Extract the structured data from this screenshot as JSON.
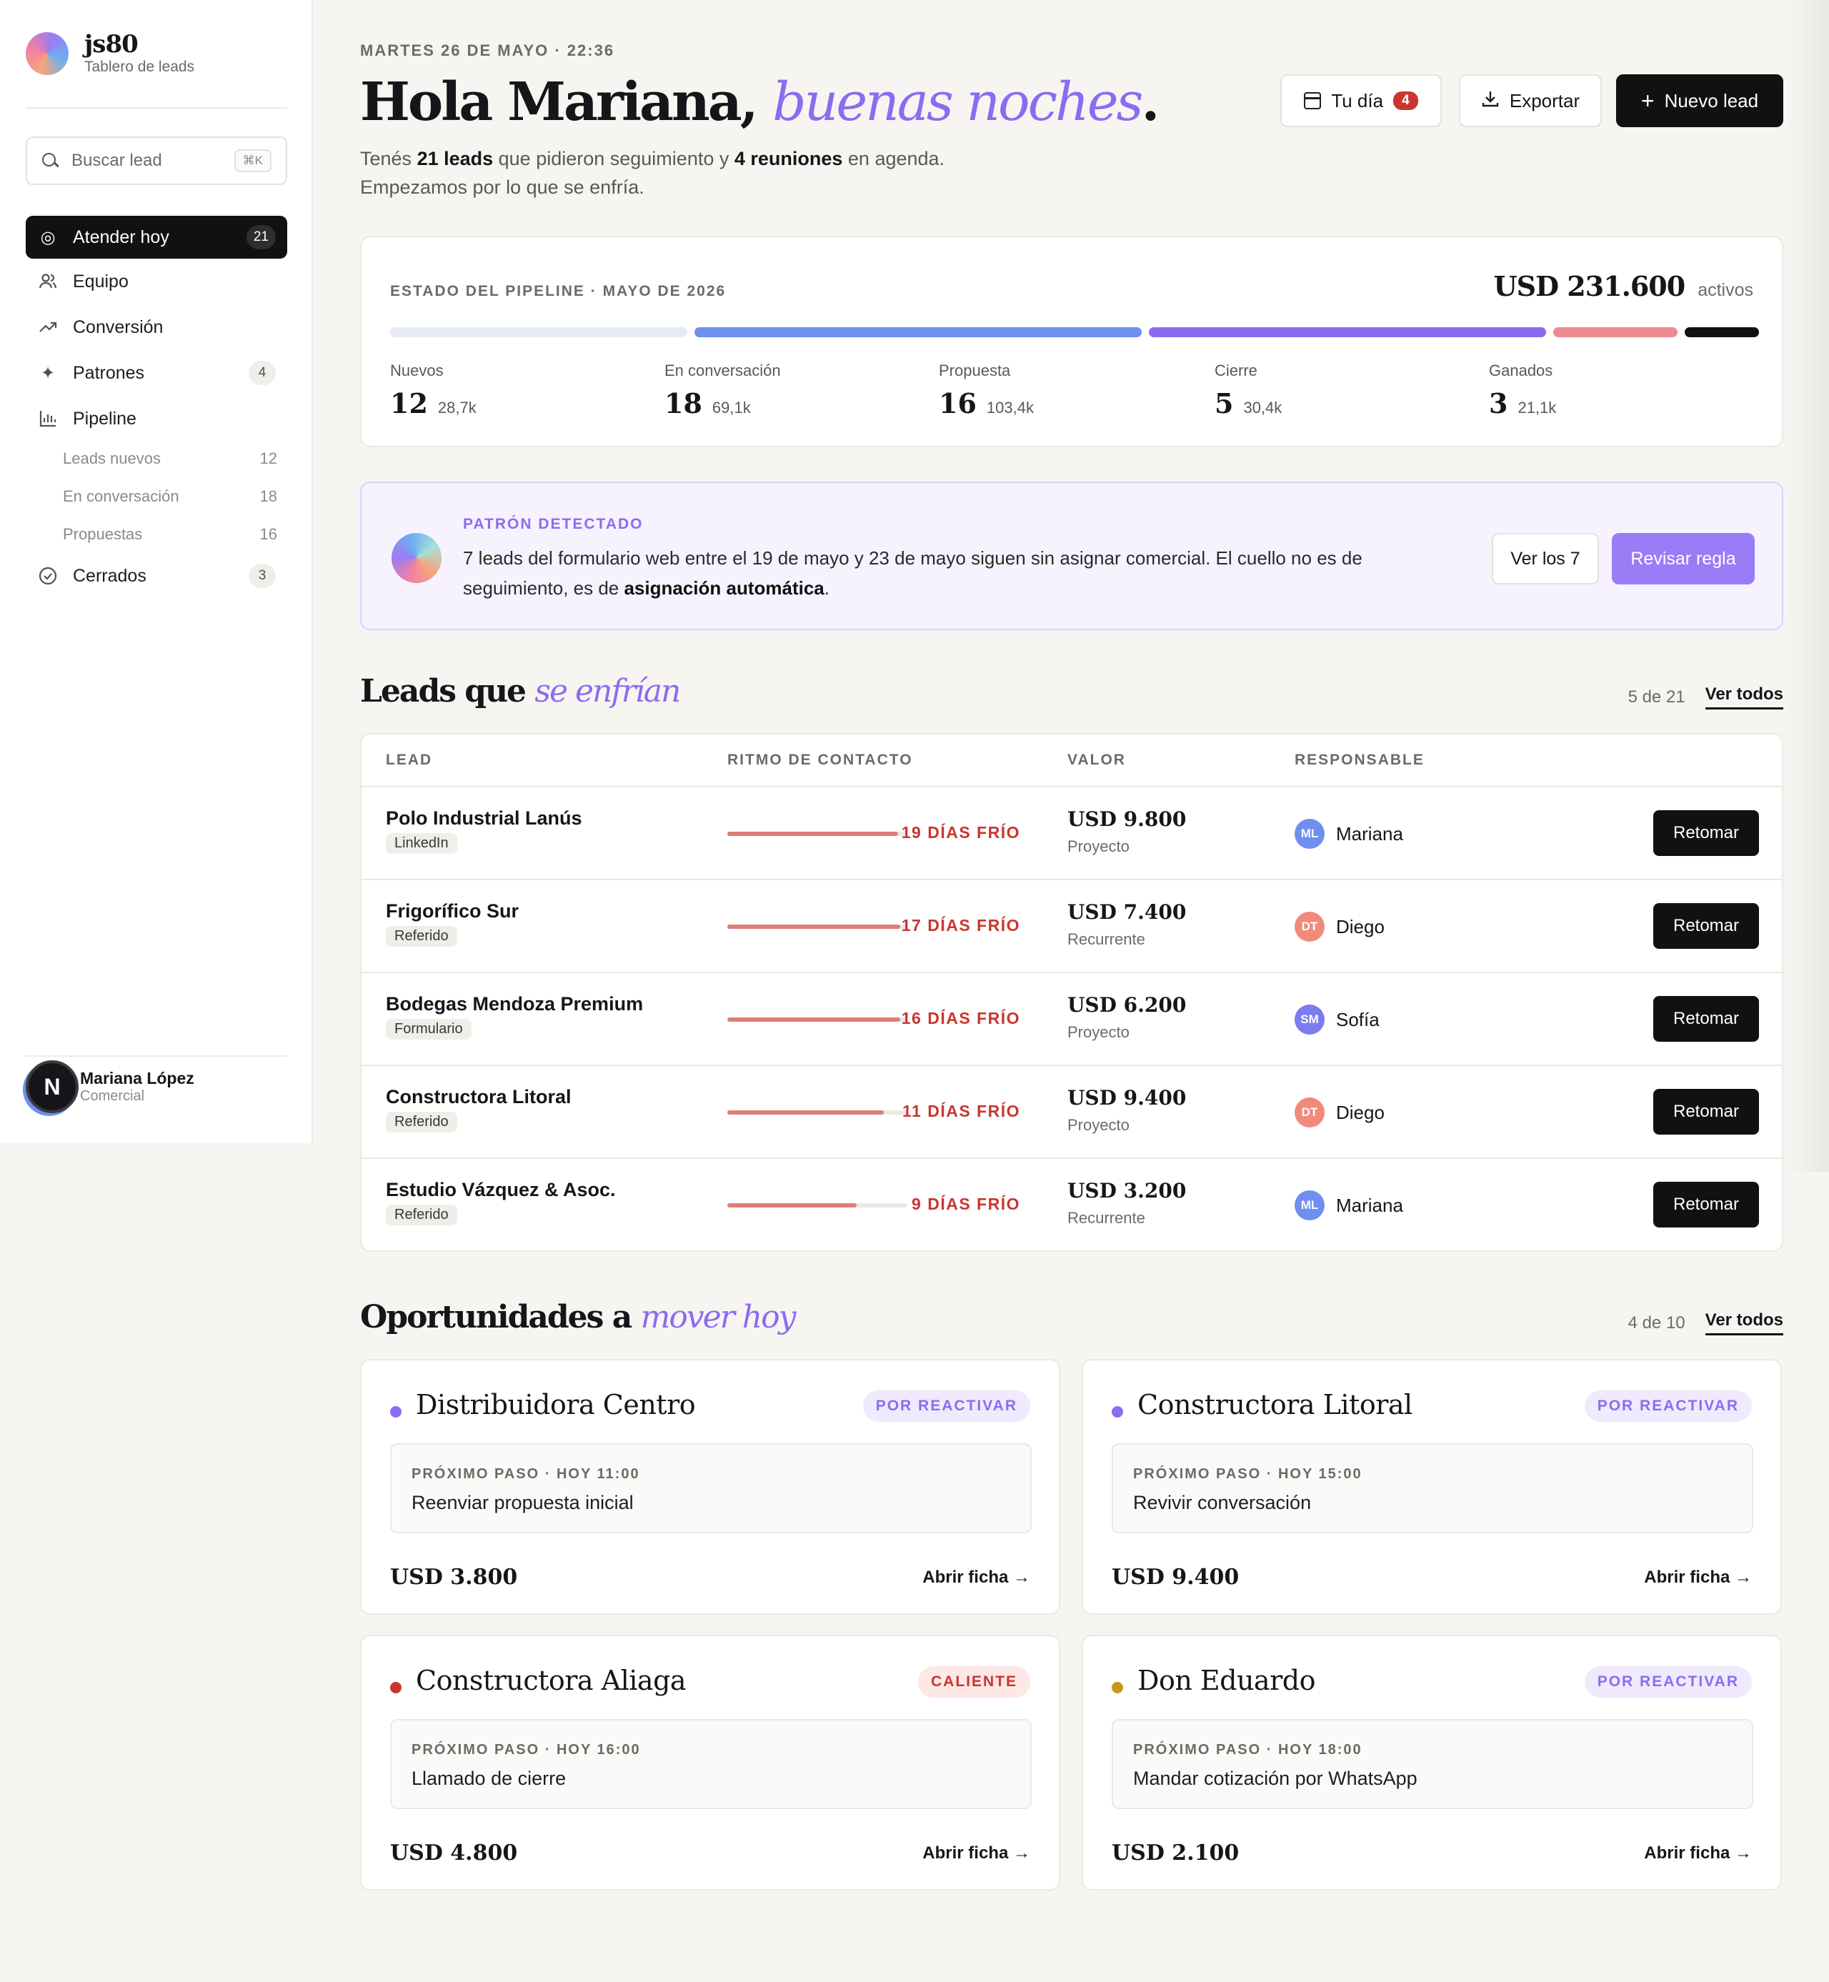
{
  "brand": {
    "name": "js80",
    "subtitle": "Tablero de leads"
  },
  "search": {
    "placeholder": "Buscar lead",
    "shortcut": "⌘K"
  },
  "nav": [
    {
      "label": "Atender hoy",
      "count": "21",
      "icon": "target-icon",
      "active": true
    },
    {
      "label": "Equipo",
      "count": "",
      "icon": "users-icon"
    },
    {
      "label": "Conversión",
      "count": "",
      "icon": "trending-up-icon"
    },
    {
      "label": "Patrones",
      "count": "4",
      "icon": "sparkles-icon"
    },
    {
      "label": "Pipeline",
      "count": "",
      "icon": "bar-chart-icon"
    }
  ],
  "pipeline_sub": [
    {
      "label": "Leads nuevos",
      "count": "12"
    },
    {
      "label": "En conversación",
      "count": "18"
    },
    {
      "label": "Propuestas",
      "count": "16"
    }
  ],
  "nav_closed": {
    "label": "Cerrados",
    "count": "3",
    "icon": "check-circle-icon"
  },
  "user": {
    "initial": "N",
    "name": "Mariana López",
    "role": "Comercial"
  },
  "header": {
    "date": "MARTES 26 DE MAYO · 22:36",
    "greeting_main": "Hola Mariana,",
    "greeting_accent": "buenas noches",
    "greeting_end": ".",
    "intro_1": "Tenés ",
    "intro_leads": "21 leads",
    "intro_2": " que pidieron seguimiento y ",
    "intro_meetings": "4 reuniones",
    "intro_3": " en agenda.",
    "intro_4": "Empezamos por lo que se enfría.",
    "btn_day": "Tu día",
    "btn_day_badge": "4",
    "btn_export": "Exportar",
    "btn_new": "Nuevo lead"
  },
  "pipeline": {
    "kicker": "ESTADO DEL PIPELINE · MAYO DE 2026",
    "total": "USD 231.600",
    "total_label": "activos",
    "stages": [
      {
        "name": "Nuevos",
        "count": "12",
        "value": "28,7k",
        "color": "#e6ebf6"
      },
      {
        "name": "En conversación",
        "count": "18",
        "value": "69,1k",
        "color": "#6e8ff0"
      },
      {
        "name": "Propuesta",
        "count": "16",
        "value": "103,4k",
        "color": "#8b6cf0"
      },
      {
        "name": "Cierre",
        "count": "5",
        "value": "30,4k",
        "color": "#f08a90"
      },
      {
        "name": "Ganados",
        "count": "3",
        "value": "21,1k",
        "color": "#111111"
      }
    ]
  },
  "pattern": {
    "kicker": "PATRÓN DETECTADO",
    "text_1": "7 leads del formulario web entre el 19 de mayo y 23 de mayo siguen sin asignar comercial. El cuello no es de seguimiento, es de ",
    "text_bold": "asignación automática",
    "text_2": ".",
    "btn_view": "Ver los 7",
    "btn_review": "Revisar regla"
  },
  "cooling": {
    "title_main": "Leads que ",
    "title_accent": "se enfrían",
    "count": "5 de 21",
    "link": "Ver todos",
    "columns": [
      "LEAD",
      "RITMO DE CONTACTO",
      "VALOR",
      "RESPONSABLE"
    ],
    "rows": [
      {
        "name": "Polo Industrial Lanús",
        "source": "LinkedIn",
        "days": "19 DÍAS FRÍO",
        "level": 0.95,
        "amount": "USD 9.800",
        "type": "Proyecto",
        "initials": "ML",
        "owner": "Mariana",
        "avatar_color": "#6e8ff0",
        "action": "Retomar"
      },
      {
        "name": "Frigorífico Sur",
        "source": "Referido",
        "days": "17 DÍAS FRÍO",
        "level": 0.96,
        "amount": "USD 7.400",
        "type": "Recurrente",
        "initials": "DT",
        "owner": "Diego",
        "avatar_color": "#f08a7a",
        "action": "Retomar"
      },
      {
        "name": "Bodegas Mendoza Premium",
        "source": "Formulario",
        "days": "16 DÍAS FRÍO",
        "level": 0.96,
        "amount": "USD 6.200",
        "type": "Proyecto",
        "initials": "SM",
        "owner": "Sofía",
        "avatar_color": "#7a7cf0",
        "action": "Retomar"
      },
      {
        "name": "Constructora Litoral",
        "source": "Referido",
        "days": "11 DÍAS FRÍO",
        "level": 0.87,
        "amount": "USD 9.400",
        "type": "Proyecto",
        "initials": "DT",
        "owner": "Diego",
        "avatar_color": "#f08a7a",
        "action": "Retomar"
      },
      {
        "name": "Estudio Vázquez & Asoc.",
        "source": "Referido",
        "days": "9 DÍAS FRÍO",
        "level": 0.72,
        "amount": "USD 3.200",
        "type": "Recurrente",
        "initials": "ML",
        "owner": "Mariana",
        "avatar_color": "#6e8ff0",
        "action": "Retomar"
      }
    ]
  },
  "opportunities": {
    "title_main": "Oportunidades a ",
    "title_accent": "mover hoy",
    "count": "4 de 10",
    "link": "Ver todos",
    "cards": [
      {
        "name": "Distribuidora Centro",
        "status": "POR REACTIVAR",
        "status_kind": "react",
        "dot": "#8b6cf0",
        "step_label": "PRÓXIMO PASO · HOY 11:00",
        "step": "Reenviar propuesta inicial",
        "amount": "USD 3.800",
        "link": "Abrir ficha →"
      },
      {
        "name": "Constructora Litoral",
        "status": "POR REACTIVAR",
        "status_kind": "react",
        "dot": "#8b6cf0",
        "step_label": "PRÓXIMO PASO · HOY 15:00",
        "step": "Revivir conversación",
        "amount": "USD 9.400",
        "link": "Abrir ficha →"
      },
      {
        "name": "Constructora Aliaga",
        "status": "CALIENTE",
        "status_kind": "hot",
        "dot": "#c8362f",
        "step_label": "PRÓXIMO PASO · HOY 16:00",
        "step": "Llamado de cierre",
        "amount": "USD 4.800",
        "link": "Abrir ficha →"
      },
      {
        "name": "Don Eduardo",
        "status": "POR REACTIVAR",
        "status_kind": "react",
        "dot": "#c8961e",
        "step_label": "PRÓXIMO PASO · HOY 18:00",
        "step": "Mandar cotización por WhatsApp",
        "amount": "USD 2.100",
        "link": "Abrir ficha →"
      }
    ]
  }
}
